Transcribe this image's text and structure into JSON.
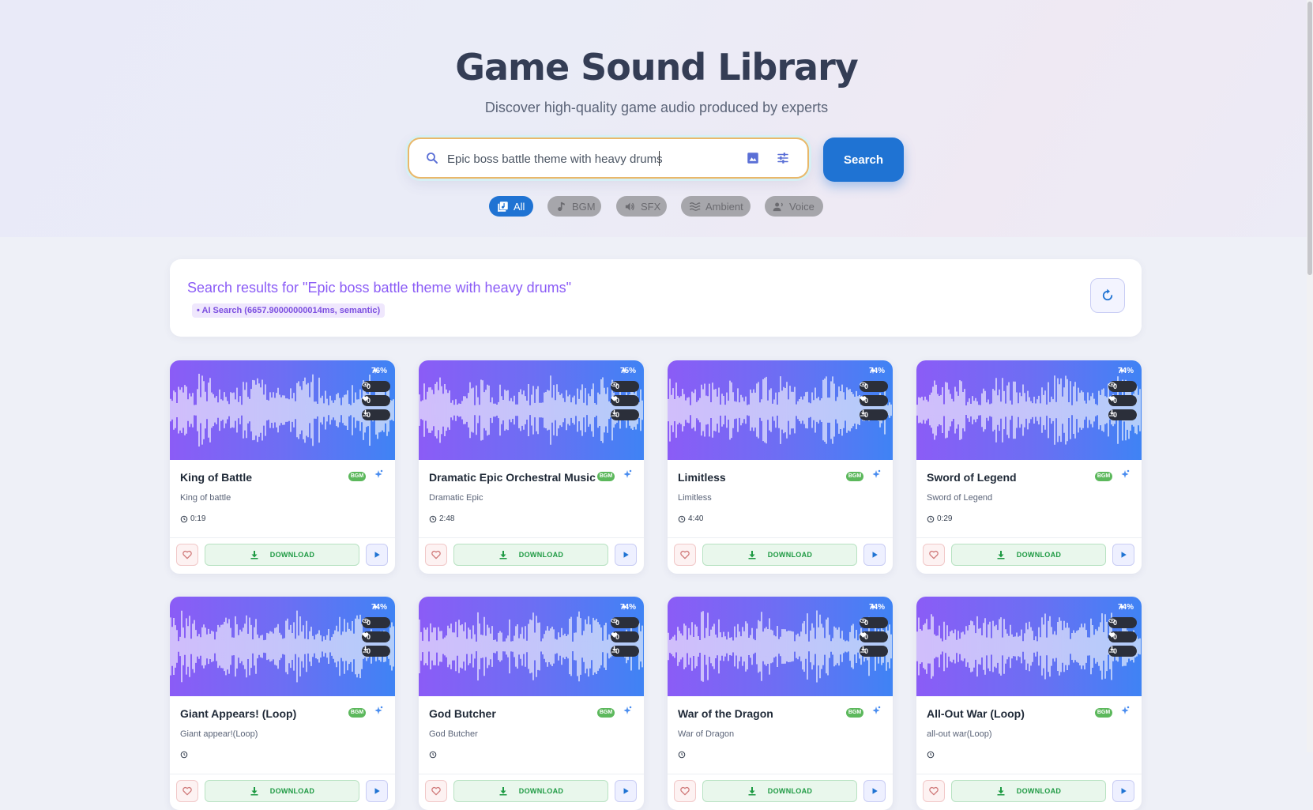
{
  "header": {
    "title": "Game Sound Library",
    "subtitle": "Discover high-quality game audio produced by experts"
  },
  "search": {
    "value": "Epic boss battle theme with heavy drums",
    "button_label": "Search"
  },
  "filters": [
    {
      "label": "All",
      "active": true,
      "icon": "library-music-icon"
    },
    {
      "label": "BGM",
      "active": false,
      "icon": "music-note-icon"
    },
    {
      "label": "SFX",
      "active": false,
      "icon": "volume-icon"
    },
    {
      "label": "Ambient",
      "active": false,
      "icon": "waves-icon"
    },
    {
      "label": "Voice",
      "active": false,
      "icon": "voice-icon"
    }
  ],
  "results": {
    "title": "Search results for \"Epic boss battle theme with heavy drums\"",
    "badge": "• AI Search (6657.90000000014ms, semantic)"
  },
  "card_labels": {
    "category": "BGM",
    "download": "DOWNLOAD"
  },
  "colors": {
    "accent": "#1f73d3",
    "purple": "#8b5cf6",
    "download_green": "#1e9a43",
    "bgm_badge": "#5cb85c"
  },
  "cards": [
    {
      "title": "King of Battle",
      "subtitle": "King of battle",
      "match": "76%",
      "views": "0",
      "likes": "0",
      "downloads": "0",
      "duration": "0:19"
    },
    {
      "title": "Dramatic Epic Orchestral Music",
      "subtitle": "Dramatic Epic",
      "match": "75%",
      "views": "0",
      "likes": "0",
      "downloads": "0",
      "duration": "2:48"
    },
    {
      "title": "Limitless",
      "subtitle": "Limitless",
      "match": "74%",
      "views": "0",
      "likes": "0",
      "downloads": "0",
      "duration": "4:40"
    },
    {
      "title": "Sword of Legend",
      "subtitle": "Sword of Legend",
      "match": "74%",
      "views": "0",
      "likes": "0",
      "downloads": "0",
      "duration": "0:29"
    },
    {
      "title": "Giant Appears! (Loop)",
      "subtitle": "Giant appear!(Loop)",
      "match": "74%",
      "views": "0",
      "likes": "0",
      "downloads": "0",
      "duration": ""
    },
    {
      "title": "God Butcher",
      "subtitle": "God Butcher",
      "match": "74%",
      "views": "0",
      "likes": "0",
      "downloads": "0",
      "duration": ""
    },
    {
      "title": "War of the Dragon",
      "subtitle": "War of Dragon",
      "match": "74%",
      "views": "0",
      "likes": "0",
      "downloads": "0",
      "duration": ""
    },
    {
      "title": "All-Out War (Loop)",
      "subtitle": "all-out war(Loop)",
      "match": "74%",
      "views": "0",
      "likes": "0",
      "downloads": "0",
      "duration": ""
    }
  ]
}
